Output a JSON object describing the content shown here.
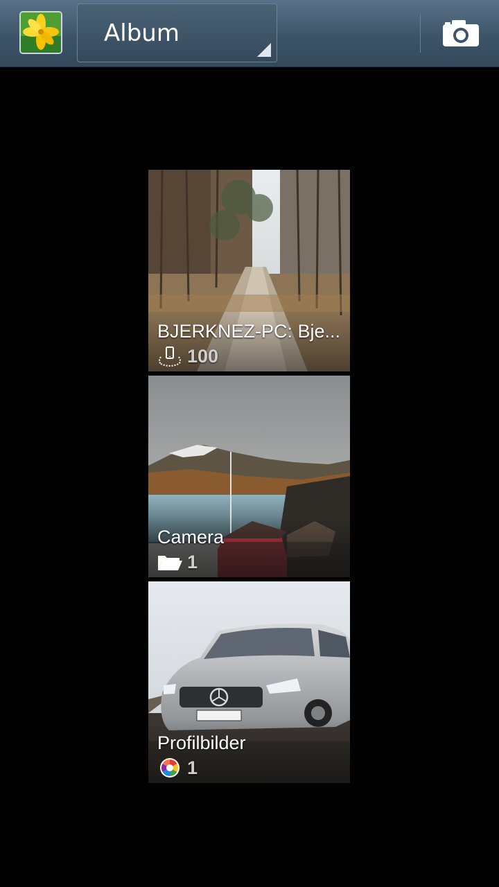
{
  "action_bar": {
    "app_icon": "gallery-flower-icon",
    "spinner_label": "Album",
    "camera_icon": "camera-icon"
  },
  "albums": [
    {
      "title": "BJERKNEZ-PC: Bje...",
      "count": "100",
      "icon": "nearby-device-icon"
    },
    {
      "title": "Camera",
      "count": "1",
      "icon": "folder-icon"
    },
    {
      "title": "Profilbilder",
      "count": "1",
      "icon": "picasa-icon"
    }
  ],
  "colors": {
    "action_bar": "#3d5468",
    "background": "#000000"
  }
}
